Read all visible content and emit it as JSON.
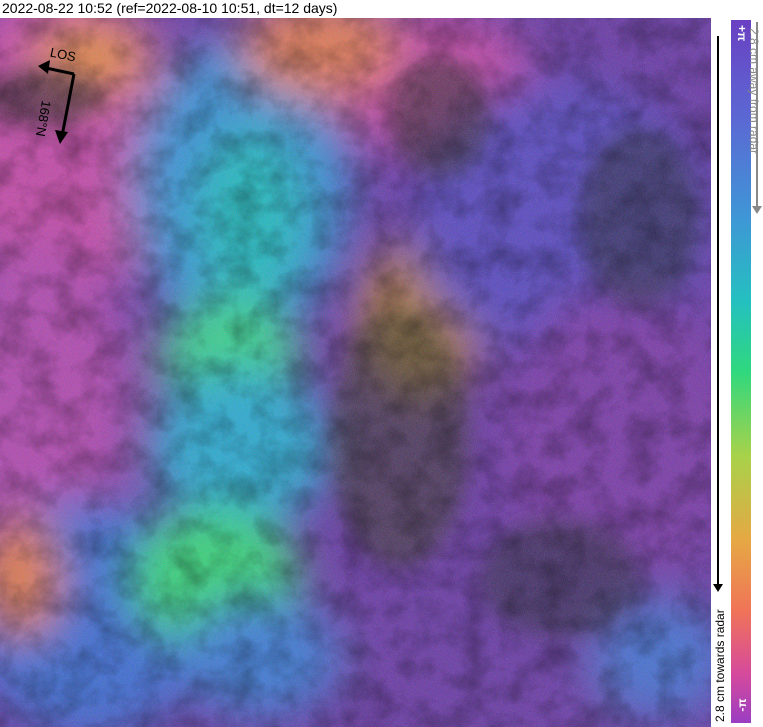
{
  "title": "2022-08-22 10:52 (ref=2022-08-10 10:51, dt=12 days)",
  "map": {
    "los_label": "LOS",
    "heading_label": "168°N",
    "colors": {
      "purple": "#6a3aa6",
      "blue": "#4a6fd0",
      "cyan": "#2fb8c8",
      "green": "#38d080",
      "pink": "#c24aa8",
      "orange": "#e0864a"
    }
  },
  "colorbar": {
    "top_label": "+π",
    "bottom_label": "-π",
    "away_label": "2.8 cm away from radar",
    "towards_label": "2.8 cm towards radar"
  }
}
